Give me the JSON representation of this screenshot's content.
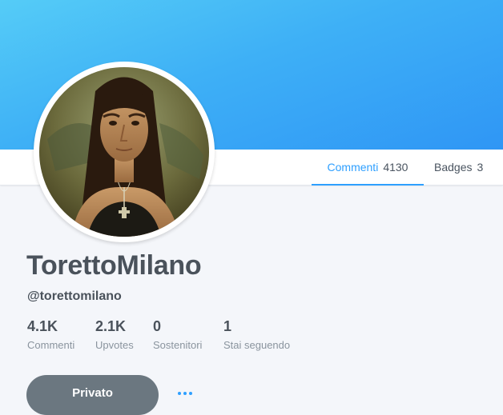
{
  "profile": {
    "display_name": "TorettoMilano",
    "handle": "@torettomilano",
    "avatar": "profile-portrait"
  },
  "tabs": [
    {
      "label": "Commenti",
      "count": "4130",
      "active": true
    },
    {
      "label": "Badges",
      "count": "3",
      "active": false
    }
  ],
  "stats": [
    {
      "value": "4.1K",
      "label": "Commenti"
    },
    {
      "value": "2.1K",
      "label": "Upvotes"
    },
    {
      "value": "0",
      "label": "Sostenitori"
    },
    {
      "value": "1",
      "label": "Stai seguendo"
    }
  ],
  "actions": {
    "private_label": "Privato",
    "more_icon": "more-dots-icon"
  },
  "colors": {
    "accent": "#2e9fff",
    "banner_top": "#55ccf7",
    "banner_bottom": "#2f96f5",
    "text": "#4a525b",
    "muted": "#8a949e",
    "button": "#6b7780"
  }
}
